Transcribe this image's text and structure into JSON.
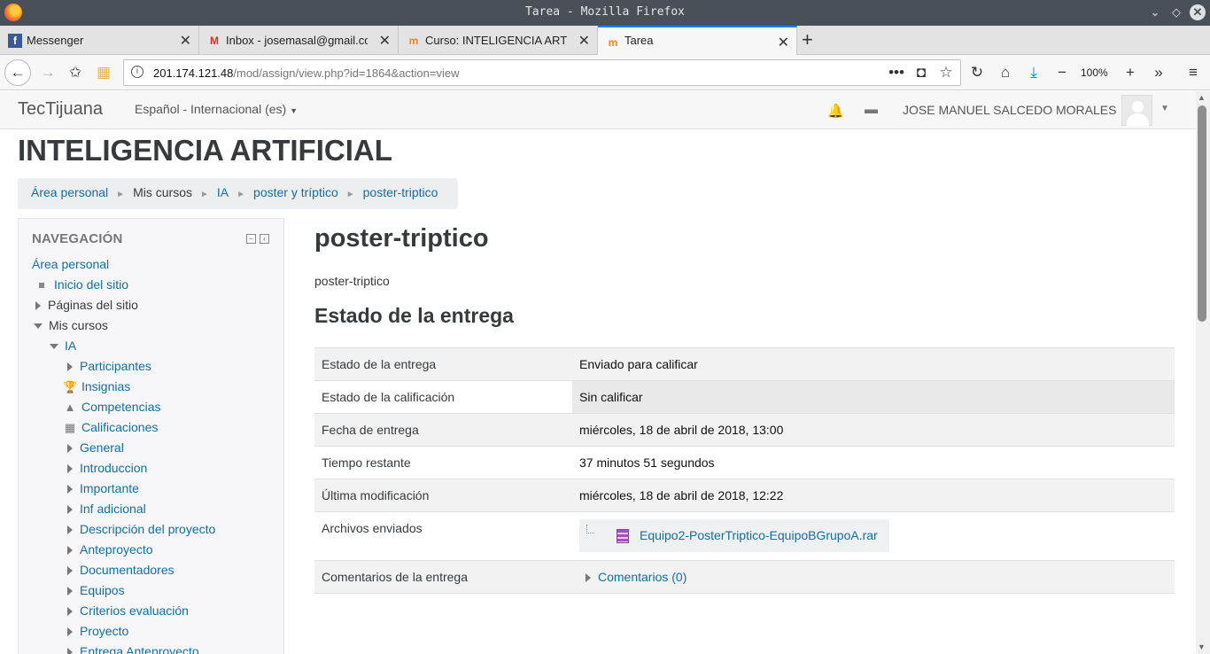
{
  "window": {
    "title": "Tarea - Mozilla Firefox"
  },
  "tabs": [
    {
      "label": "Messenger",
      "icon": "facebook-icon"
    },
    {
      "label": "Inbox - josemasal@gmail.co",
      "icon": "gmail-icon"
    },
    {
      "label": "Curso: INTELIGENCIA ARTIF",
      "icon": "moodle-icon"
    },
    {
      "label": "Tarea",
      "icon": "moodle-icon",
      "active": true
    }
  ],
  "urlbar": {
    "host": "201.174.121.48",
    "path": "/mod/assign/view.php?id=1864&action=view"
  },
  "zoom": "100%",
  "site": {
    "brand": "TecTijuana",
    "language": "Español - Internacional (es)",
    "user": "JOSE MANUEL SALCEDO MORALES"
  },
  "course_title": "INTELIGENCIA ARTIFICIAL",
  "breadcrumb": [
    "Área personal",
    "Mis cursos",
    "IA",
    "poster y tríptico",
    "poster-triptico"
  ],
  "navigation": {
    "title": "NAVEGACIÓN",
    "items": [
      {
        "label": "Área personal"
      },
      {
        "label": "Inicio del sitio"
      },
      {
        "label": "Páginas del sitio"
      },
      {
        "label": "Mis cursos"
      },
      {
        "label": "IA"
      },
      {
        "label": "Participantes"
      },
      {
        "label": "Insignias"
      },
      {
        "label": "Competencias"
      },
      {
        "label": "Calificaciones"
      },
      {
        "label": "General"
      },
      {
        "label": "Introduccion"
      },
      {
        "label": "Importante"
      },
      {
        "label": "Inf adicional"
      },
      {
        "label": "Descripción del proyecto"
      },
      {
        "label": "Anteproyecto"
      },
      {
        "label": "Documentadores"
      },
      {
        "label": "Equipos"
      },
      {
        "label": "Criterios evaluación"
      },
      {
        "label": "Proyecto"
      },
      {
        "label": "Entrega Anteproyecto"
      }
    ]
  },
  "assignment": {
    "title": "poster-triptico",
    "description": "poster-triptico",
    "status_heading": "Estado de la entrega",
    "rows": [
      {
        "label": "Estado de la entrega",
        "value": "Enviado para calificar"
      },
      {
        "label": "Estado de la calificación",
        "value": "Sin calificar"
      },
      {
        "label": "Fecha de entrega",
        "value": "miércoles, 18 de abril de 2018, 13:00"
      },
      {
        "label": "Tiempo restante",
        "value": "37 minutos 51 segundos"
      },
      {
        "label": "Última modificación",
        "value": "miércoles, 18 de abril de 2018, 12:22"
      }
    ],
    "files_label": "Archivos enviados",
    "file_name": "Equipo2-PosterTriptico-EquipoBGrupoA.rar",
    "comments_label": "Comentarios de la entrega",
    "comments_link": "Comentarios (0)"
  }
}
